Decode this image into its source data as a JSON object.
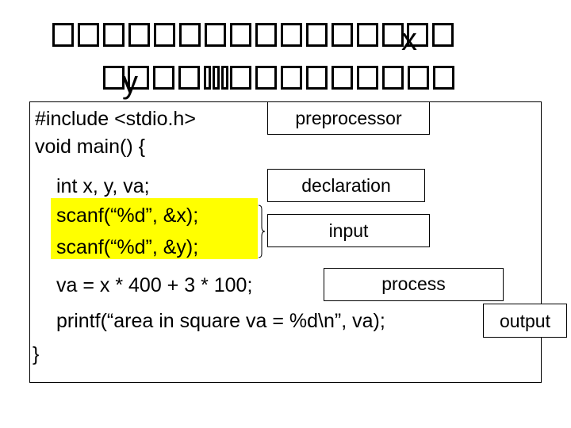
{
  "title": {
    "line1": {
      "boxes_before": 15,
      "letter": "x",
      "boxes_after": 1
    },
    "line2": {
      "boxes_before": 2,
      "letter": "y",
      "boxes_mid": 2,
      "narrow_boxes": 3,
      "boxes_after": 9
    }
  },
  "code": {
    "lines": [
      "#include <stdio.h>",
      "void main() {",
      "int x, y, va;",
      "scanf(“%d”, &x);",
      "scanf(“%d”, &y);",
      "va = x * 400 + 3 * 100;",
      "printf(“area in square va = %d\\n”, va);",
      "}"
    ],
    "highlighted_lines": [
      3,
      4
    ],
    "highlight_color": "#ffff00"
  },
  "labels": {
    "preprocessor": "preprocessor",
    "declaration": "declaration",
    "input": "input",
    "process": "process",
    "output": "output"
  }
}
